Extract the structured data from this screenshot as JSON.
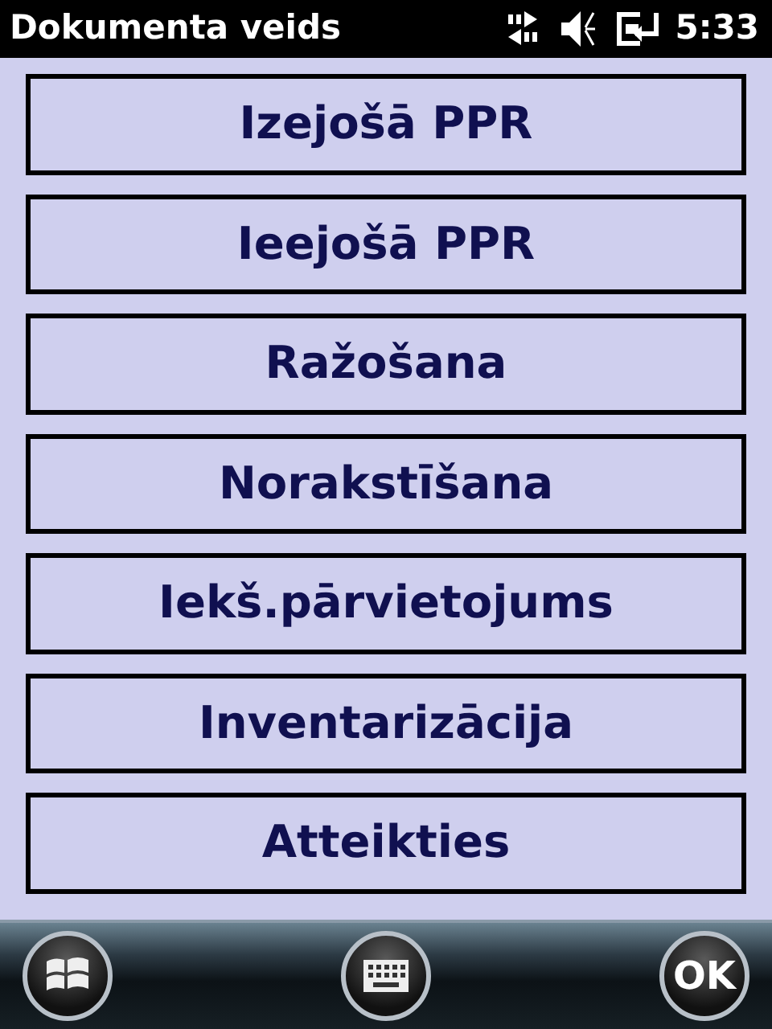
{
  "title_bar": {
    "title": "Dokumenta veids",
    "time": "5:33"
  },
  "menu_buttons": [
    {
      "label": "Izejošā PPR"
    },
    {
      "label": "Ieejošā PPR"
    },
    {
      "label": "Ražošana"
    },
    {
      "label": "Norakstīšana"
    },
    {
      "label": "Iekš.pārvietojums"
    },
    {
      "label": "Inventarizācija"
    },
    {
      "label": "Atteikties"
    }
  ],
  "soft_keys": [
    {
      "kind": "start"
    },
    {
      "kind": "keyboard"
    },
    {
      "kind": "text",
      "label": "OK"
    }
  ]
}
